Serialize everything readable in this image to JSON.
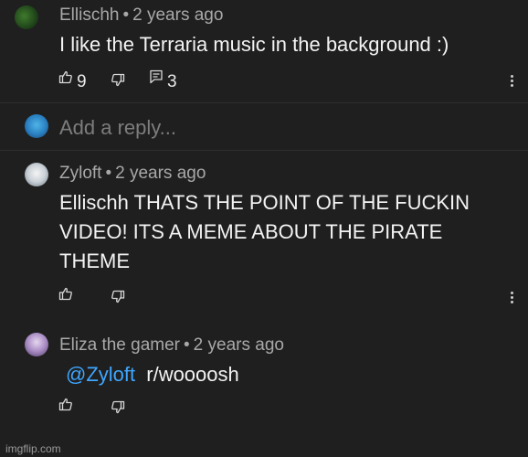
{
  "comments": [
    {
      "author": "Ellischh",
      "separator": "•",
      "time": "2 years ago",
      "lines": [
        "I like the Terraria music in the background :)"
      ],
      "like_count": "9",
      "reply_count": "3"
    },
    {
      "author": "Zyloft",
      "separator": "•",
      "time": "2 years ago",
      "lines": [
        "Ellischh THATS THE POINT OF THE FUCKIN",
        "VIDEO! ITS A MEME ABOUT THE PIRATE",
        "THEME"
      ]
    },
    {
      "author": "Eliza the gamer",
      "separator": "•",
      "time": "2 years ago",
      "mention": "@Zyloft",
      "text": "r/woooosh"
    }
  ],
  "reply_box": {
    "placeholder": "Add a reply..."
  },
  "watermark": "imgflip.com",
  "icons": {
    "like": "thumbs-up-icon",
    "dislike": "thumbs-down-icon",
    "reply": "reply-icon",
    "more": "more-vertical-icon"
  },
  "colors": {
    "background": "#1f1f1f",
    "mention": "#3ea6ff",
    "meta": "#a8a8a8"
  }
}
